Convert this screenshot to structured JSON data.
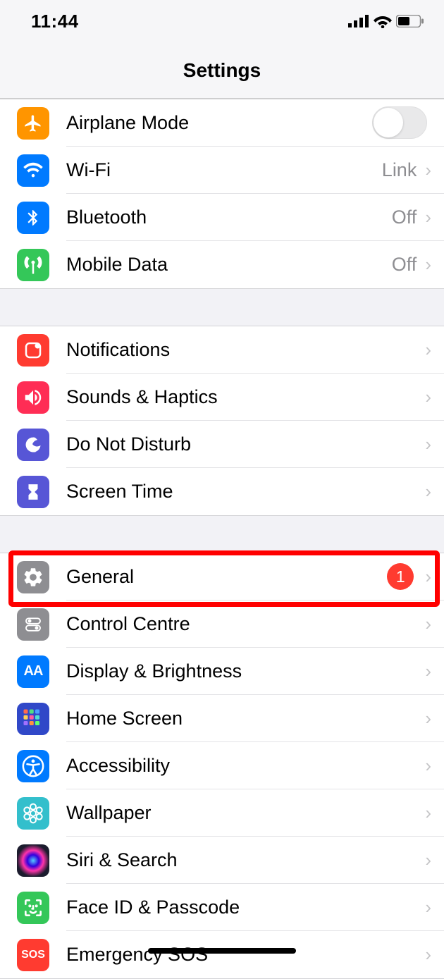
{
  "status": {
    "time": "11:44"
  },
  "header": {
    "title": "Settings"
  },
  "group1": [
    {
      "label": "Airplane Mode",
      "icon": "airplane",
      "color": "#ff9500",
      "control": "toggle"
    },
    {
      "label": "Wi-Fi",
      "icon": "wifi",
      "color": "#007aff",
      "value": "Link"
    },
    {
      "label": "Bluetooth",
      "icon": "bluetooth",
      "color": "#007aff",
      "value": "Off"
    },
    {
      "label": "Mobile Data",
      "icon": "antenna",
      "color": "#34c759",
      "value": "Off"
    }
  ],
  "group2": [
    {
      "label": "Notifications",
      "icon": "notifications",
      "color": "#ff3b30"
    },
    {
      "label": "Sounds & Haptics",
      "icon": "sounds",
      "color": "#ff2d55"
    },
    {
      "label": "Do Not Disturb",
      "icon": "moon",
      "color": "#5756d6"
    },
    {
      "label": "Screen Time",
      "icon": "hourglass",
      "color": "#5756d6"
    }
  ],
  "group3": [
    {
      "label": "General",
      "icon": "gear",
      "color": "#8e8e92",
      "badge": "1"
    },
    {
      "label": "Control Centre",
      "icon": "switches",
      "color": "#8e8e92"
    },
    {
      "label": "Display & Brightness",
      "icon": "aa",
      "color": "#007aff"
    },
    {
      "label": "Home Screen",
      "icon": "grid",
      "color": "#3355cc"
    },
    {
      "label": "Accessibility",
      "icon": "accessibility",
      "color": "#007aff"
    },
    {
      "label": "Wallpaper",
      "icon": "flower",
      "color": "#38bec9"
    },
    {
      "label": "Siri & Search",
      "icon": "siri",
      "color": "#1c1c1e"
    },
    {
      "label": "Face ID & Passcode",
      "icon": "faceid",
      "color": "#34c759"
    },
    {
      "label": "Emergency SOS",
      "icon": "sos",
      "color": "#ff3b30"
    }
  ]
}
